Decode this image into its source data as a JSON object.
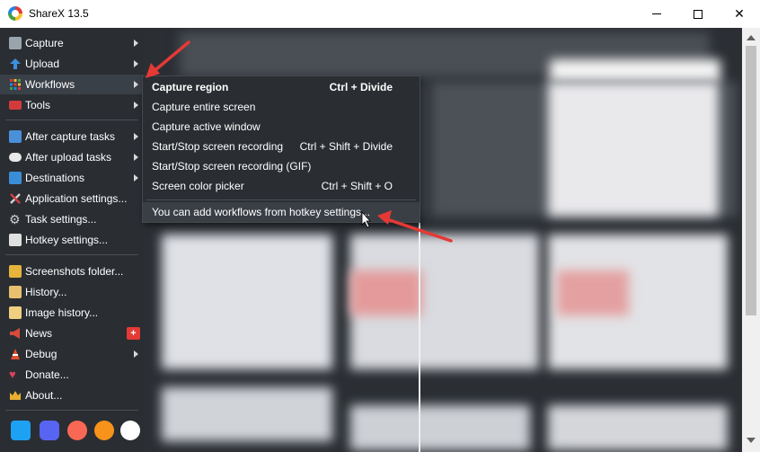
{
  "window": {
    "title": "ShareX 13.5"
  },
  "sidebar": {
    "items": [
      {
        "label": "Capture",
        "icon": "capture-icon",
        "color": "#9aa4ad",
        "arrow": true
      },
      {
        "label": "Upload",
        "icon": "upload-arrow-icon",
        "color": "#3d8fe0",
        "arrow": true
      },
      {
        "label": "Workflows",
        "icon": "workflow-grid-icon",
        "color": "#e0b030",
        "arrow": true
      },
      {
        "label": "Tools",
        "icon": "toolbox-icon",
        "color": "#d23b3b",
        "arrow": true
      },
      {
        "label": "After capture tasks",
        "icon": "after-capture-icon",
        "color": "#4a90d9",
        "arrow": true
      },
      {
        "label": "After upload tasks",
        "icon": "cloud-icon",
        "color": "#e8e8e8",
        "arrow": true
      },
      {
        "label": "Destinations",
        "icon": "destinations-icon",
        "color": "#3a8ed8",
        "arrow": true
      },
      {
        "label": "Application settings...",
        "icon": "wrench-screwdriver-icon",
        "color": "#d04040",
        "arrow": false
      },
      {
        "label": "Task settings...",
        "icon": "gear-icon",
        "color": "#bfbfbf",
        "arrow": false
      },
      {
        "label": "Hotkey settings...",
        "icon": "keyboard-icon",
        "color": "#e0e0e0",
        "arrow": false
      },
      {
        "label": "Screenshots folder...",
        "icon": "folder-icon",
        "color": "#e6b43a",
        "arrow": false
      },
      {
        "label": "History...",
        "icon": "history-icon",
        "color": "#e8c070",
        "arrow": false
      },
      {
        "label": "Image history...",
        "icon": "image-history-icon",
        "color": "#f0d080",
        "arrow": false
      },
      {
        "label": "News",
        "icon": "megaphone-icon",
        "color": "#d84a3a",
        "arrow": false
      },
      {
        "label": "Debug",
        "icon": "traffic-cone-icon",
        "color": "#e05030",
        "arrow": true
      },
      {
        "label": "Donate...",
        "icon": "heart-icon",
        "color": "#e0405a",
        "arrow": false
      },
      {
        "label": "About...",
        "icon": "crown-icon",
        "color": "#e8b030",
        "arrow": false
      }
    ],
    "news_badge": "+",
    "social": [
      {
        "icon": "twitter-icon",
        "color": "#1da1f2"
      },
      {
        "icon": "discord-icon",
        "color": "#5865f2"
      },
      {
        "icon": "patreon-icon",
        "color": "#f96854"
      },
      {
        "icon": "bitcoin-icon",
        "color": "#f7931a"
      },
      {
        "icon": "github-icon",
        "color": "#ffffff"
      }
    ]
  },
  "submenu": {
    "items": [
      {
        "label": "Capture region",
        "shortcut": "Ctrl + Divide",
        "bold": true
      },
      {
        "label": "Capture entire screen",
        "shortcut": ""
      },
      {
        "label": "Capture active window",
        "shortcut": ""
      },
      {
        "label": "Start/Stop screen recording",
        "shortcut": "Ctrl + Shift + Divide"
      },
      {
        "label": "Start/Stop screen recording (GIF)",
        "shortcut": ""
      },
      {
        "label": "Screen color picker",
        "shortcut": "Ctrl + Shift + O"
      }
    ],
    "footer": "You can add workflows from hotkey settings..."
  },
  "colors": {
    "annotation_arrow": "#e53935",
    "menu_bg": "#2a2e33",
    "accent": "#3a4047"
  }
}
